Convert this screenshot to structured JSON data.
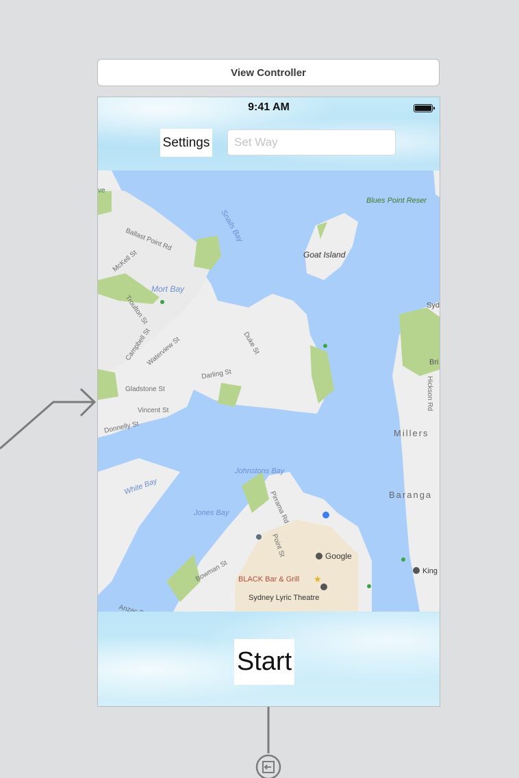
{
  "scene": {
    "title": "View Controller"
  },
  "status_bar": {
    "time": "9:41 AM",
    "battery_icon": "battery-full-icon"
  },
  "top_bar": {
    "settings_label": "Settings",
    "way_field": {
      "value": "",
      "placeholder": "Set Way"
    }
  },
  "map": {
    "labels": {
      "snails_bay": "Snails Bay",
      "blues_point": "Blues Point Reser",
      "ballast_point": "Ballast Point Rd",
      "mckell": "McKell St",
      "goat_island": "Goat Island",
      "mort_bay": "Mort Bay",
      "troulton": "Troulton St",
      "sydney": "Sydne",
      "campbell": "Campbell St",
      "waterview": "Waterview St",
      "duke": "Duke St",
      "darling": "Darling St",
      "gladstone": "Gladstone St",
      "bri": "Bri",
      "hickson": "Hickson Rd",
      "vincent": "Vincent St",
      "donnelly": "Donnelly St",
      "millers": "Millers",
      "white_bay": "White Bay",
      "johnstons_bay": "Johnstons Bay",
      "pirrama": "Pirrama Rd",
      "baranga": "Baranga",
      "jones_bay": "Jones Bay",
      "point_st": "Point St",
      "google": "Google",
      "bowman": "Bowman St",
      "king": "King",
      "black_bar": "BLACK Bar & Grill",
      "lyric": "Sydney Lyric Theatre",
      "anzac": "Anzac Bri",
      "ve": "ve"
    },
    "colors": {
      "water": "#a9cefa",
      "land": "#eeeeee",
      "park": "#b7d48f",
      "urban": "#f1e6d2",
      "label_water": "#6b8fd1",
      "label_park": "#3f7a2c",
      "label_street": "#6d6d6d",
      "poi": "#b3493b"
    }
  },
  "bottom_bar": {
    "start_label": "Start"
  },
  "storyboard": {
    "segue_arrow_icon": "entry-arrow-icon",
    "exit_icon": "exit-connector-icon"
  }
}
